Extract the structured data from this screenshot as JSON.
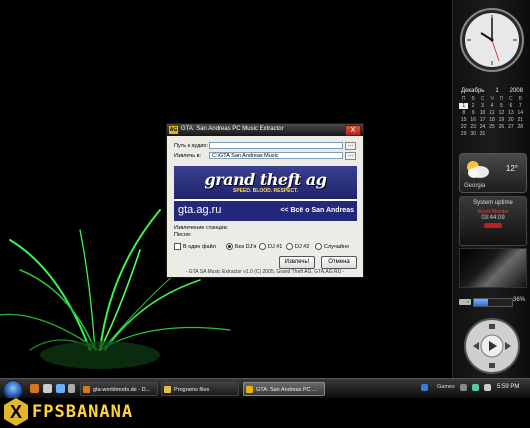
{
  "dialog": {
    "title": "GTA: San Andreas PC Music Extractor",
    "icon_text": "AG",
    "close_label": "X",
    "audio_path_label": "Путь к аудио:",
    "audio_path_value": "",
    "extract_to_label": "Извлечь в:",
    "extract_to_value": "C:\\GTA San Andreas Music",
    "browse_label": "...",
    "banner": {
      "logo_main": "grand theft ag",
      "logo_sub": "SPEED. BLOOD. RESPECT.",
      "site": "gta.ag.ru",
      "all_about": "<< Всё о San Andreas"
    },
    "status_label": "Извлечение станции:",
    "song_label": "Песня:",
    "options": {
      "single_file": "В один файл",
      "no_dj": "Без DJ'я",
      "dj1": "DJ #1",
      "dj2": "DJ #2",
      "random": "Случайно",
      "selected": "no_dj"
    },
    "extract_button": "Извлечь!",
    "cancel_button": "Отмена",
    "footer": "- GTA SA Music Extractor v1.0 (C) 2005, Grand Theft AG, GTA.AG.RU -"
  },
  "sidebar": {
    "calendar": {
      "month": "Декабрь",
      "day": "1",
      "year": "2008",
      "weekdays": [
        "П",
        "В",
        "С",
        "Ч",
        "П",
        "С",
        "В"
      ],
      "rows": [
        [
          "1",
          "2",
          "3",
          "4",
          "5",
          "6",
          "7"
        ],
        [
          "8",
          "9",
          "10",
          "11",
          "12",
          "13",
          "14"
        ],
        [
          "15",
          "16",
          "17",
          "18",
          "19",
          "20",
          "21"
        ],
        [
          "22",
          "23",
          "24",
          "25",
          "26",
          "27",
          "28"
        ],
        [
          "29",
          "30",
          "31",
          "",
          "",
          "",
          ""
        ]
      ],
      "today": "1"
    },
    "weather": {
      "temp": "12°",
      "city": "Georgia"
    },
    "uptime": {
      "title": "System uptime",
      "label": "Reset Monitor",
      "value": "03:44:09"
    },
    "cpu": {
      "percent_label": "36%",
      "level": 0.36
    }
  },
  "taskbar": {
    "tasks": [
      {
        "label": "gta-worldmods.de - D...",
        "color": "#d87a1a"
      },
      {
        "label": "Programs files",
        "color": "#e2c04a"
      },
      {
        "label": "GTA: San Andreas PC ...",
        "color": "#e3b600",
        "active": true
      }
    ],
    "games_label": "Games",
    "time": "5:59 PM"
  },
  "watermark": {
    "brand": "FPSBANANA",
    "x_letter": "X"
  }
}
